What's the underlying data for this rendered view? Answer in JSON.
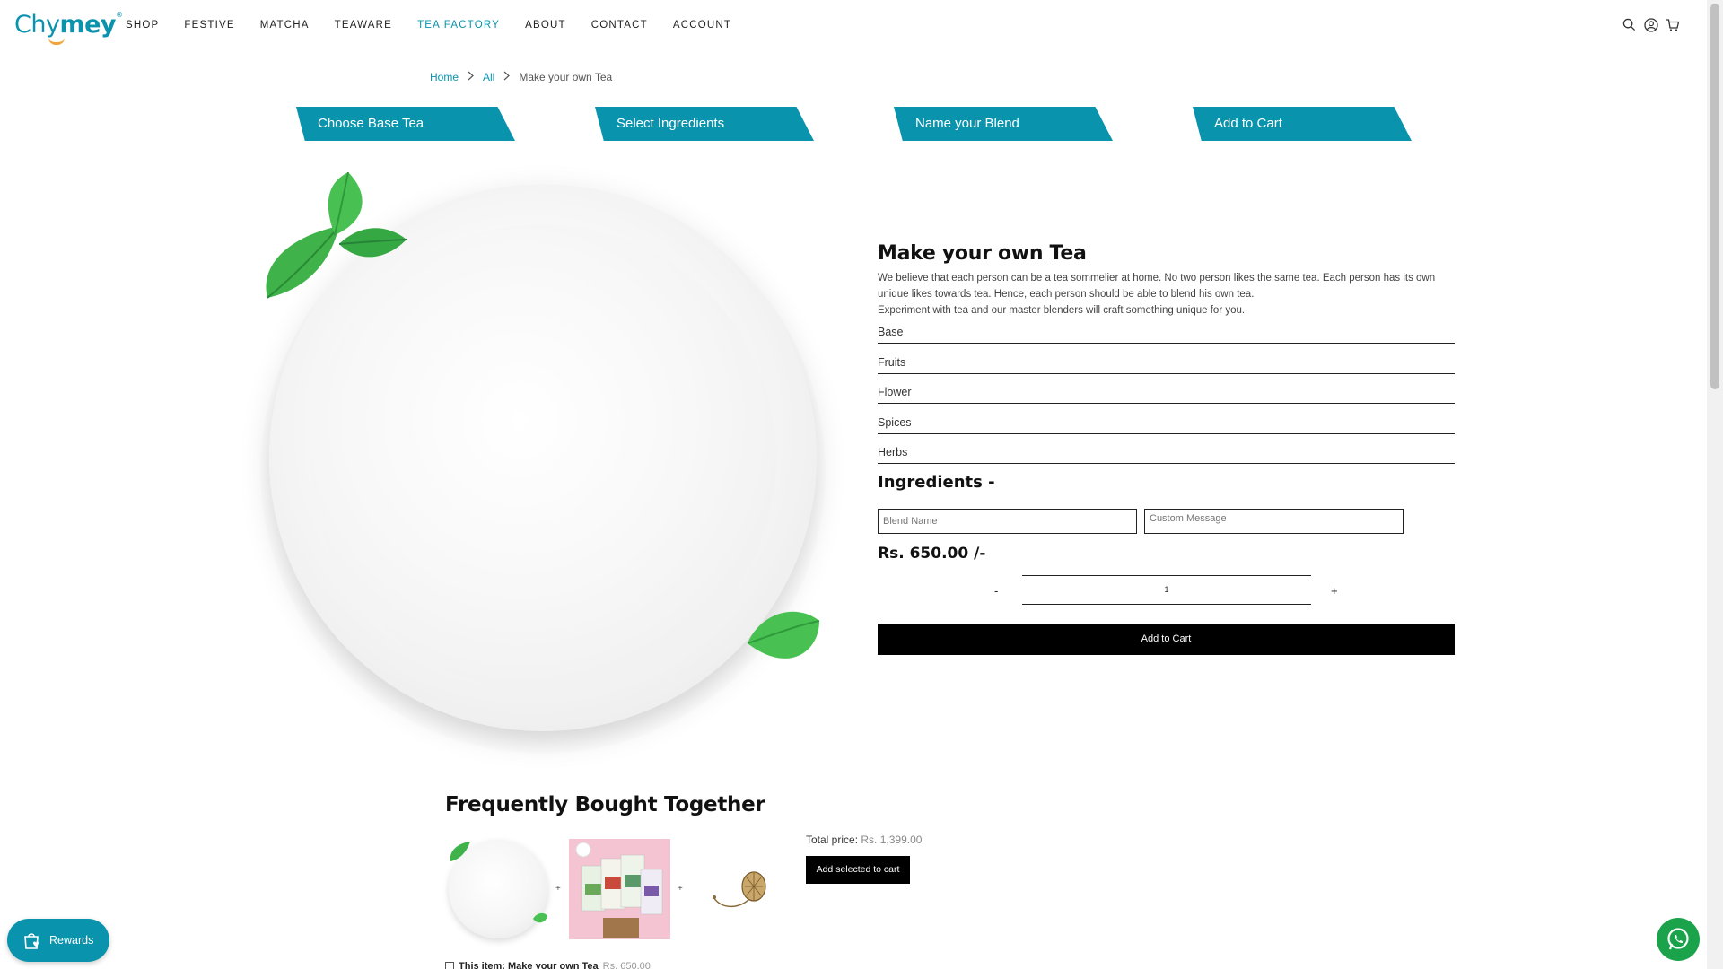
{
  "header": {
    "logo_prefix": "Chy",
    "logo_me": "mey",
    "logo_reg": "®",
    "nav": [
      "SHOP",
      "FESTIVE",
      "MATCHA",
      "TEAWARE",
      "TEA FACTORY",
      "ABOUT",
      "CONTACT",
      "ACCOUNT"
    ],
    "active_nav": "TEA FACTORY",
    "icons": [
      "search-icon",
      "account-icon",
      "cart-icon"
    ]
  },
  "breadcrumb": {
    "home": "Home",
    "all": "All",
    "current": "Make your own Tea"
  },
  "steps": [
    "Choose Base Tea",
    "Select Ingredients",
    "Name your Blend",
    "Add to Cart"
  ],
  "product": {
    "title": "Make your own Tea",
    "description_1": "We believe that each person can be a tea sommelier at home. No two person likes the same tea. Each person has its own unique likes towards tea. Hence, each person should be able to blend his own tea.",
    "description_2": "Experiment with tea and our master blenders will craft something unique for you.",
    "options": [
      "Base",
      "Fruits",
      "Flower",
      "Spices",
      "Herbs"
    ],
    "ingredients_title": "Ingredients -",
    "blend_name_placeholder": "Blend Name",
    "custom_message_placeholder": "Custom Message",
    "price": "Rs. 650.00 /-",
    "qty_minus": "-",
    "qty_value": "1",
    "qty_plus": "+",
    "add_to_cart": "Add to Cart"
  },
  "fbt": {
    "title": "Frequently Bought Together",
    "plus": "+",
    "total_label": "Total price:",
    "total_amount": "Rs. 1,399.00",
    "button": "Add selected to cart",
    "item_label": "This item: Make your own Tea",
    "item_price": "Rs. 650.00"
  },
  "widgets": {
    "rewards": "Rewards"
  },
  "colors": {
    "accent": "#0a93ad",
    "button": "#000000",
    "whatsapp": "#1aa34a"
  }
}
